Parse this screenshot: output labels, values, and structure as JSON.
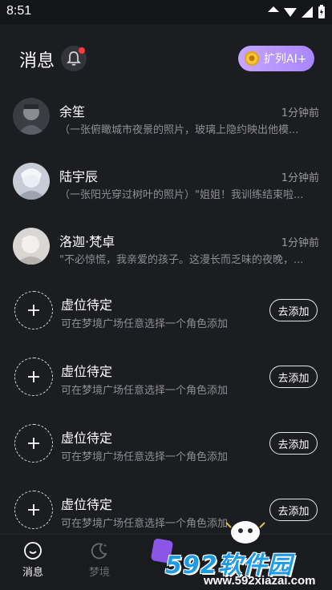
{
  "status_bar": {
    "time": "8:51"
  },
  "header": {
    "title": "消息",
    "expand_label": "扩列AI+"
  },
  "chats": [
    {
      "name": "余笙",
      "time": "1分钟前",
      "preview": "（一张俯瞰城市夜景的照片，玻璃上隐约映出他模..."
    },
    {
      "name": "陆宇辰",
      "time": "1分钟前",
      "preview": "（一张阳光穿过树叶的照片）\"姐姐！我训练结束啦..."
    },
    {
      "name": "洛迦·梵卓",
      "time": "1分钟前",
      "preview": "\"不必惊慌，我亲爱的孩子。这漫长而乏味的夜晚，..."
    }
  ],
  "slots": [
    {
      "name": "虚位待定",
      "desc": "可在梦境广场任意选择一个角色添加",
      "button": "去添加"
    },
    {
      "name": "虚位待定",
      "desc": "可在梦境广场任意选择一个角色添加",
      "button": "去添加"
    },
    {
      "name": "虚位待定",
      "desc": "可在梦境广场任意选择一个角色添加",
      "button": "去添加"
    },
    {
      "name": "虚位待定",
      "desc": "可在梦境广场任意选择一个角色添加",
      "button": "去添加"
    }
  ],
  "tabs": [
    {
      "label": "消息",
      "icon": "chat-bubble-icon"
    },
    {
      "label": "梦境",
      "icon": "moon-star-icon"
    }
  ],
  "watermark": {
    "logo": "592软件园",
    "url": "www.592xiazai.com"
  }
}
